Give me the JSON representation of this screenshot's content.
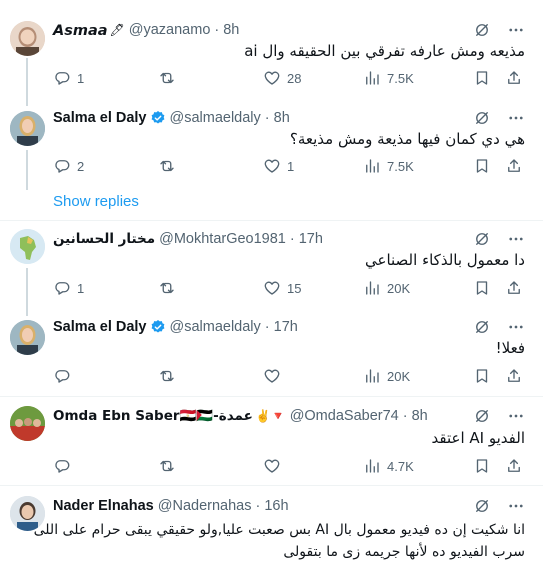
{
  "tweets": [
    {
      "name": "𝘼𝙨𝙢𝙖𝙖",
      "name_suffix": "🖊",
      "handle": "@yazanamo",
      "time": "8h",
      "verified": false,
      "text": "مذيعه ومش عارفه تفرقي بين الحقيقه وال ai",
      "replies": "1",
      "retweets": "",
      "likes": "28",
      "views": "7.5K"
    },
    {
      "name": "Salma el Daly",
      "handle": "@salmaeldaly",
      "time": "8h",
      "verified": true,
      "text": "هي دي كمان فيها مذيعة ومش مذيعة؟",
      "replies": "2",
      "retweets": "",
      "likes": "1",
      "views": "7.5K"
    },
    {
      "name": "مختار الحسانين",
      "handle": "@MokhtarGeo1981",
      "time": "17h",
      "verified": false,
      "text": "دا معمول بالذكاء الصناعي",
      "replies": "1",
      "retweets": "",
      "likes": "15",
      "views": "20K"
    },
    {
      "name": "Salma el Daly",
      "handle": "@salmaeldaly",
      "time": "17h",
      "verified": true,
      "text": "فعلا!",
      "replies": "",
      "retweets": "",
      "likes": "",
      "views": "20K"
    },
    {
      "name": "Omda Ebn Saber🇪🇬🇵🇸-عمدة",
      "name_suffix": "✌️🔻",
      "handle": "@OmdaSaber74",
      "time": "8h",
      "verified": false,
      "text": "الفديو AI اعتقد",
      "replies": "",
      "retweets": "",
      "likes": "",
      "views": "4.7K"
    },
    {
      "name": "Nader Elnahas",
      "handle": "@Nadernahas",
      "time": "16h",
      "verified": false,
      "text_line1": "انا شكيت إن ده فيديو معمول بال AI  بس صعبت عليا,ولو حقيقي يبقى حرام على اللى",
      "text_line2": "سرب الفيديو ده لأنها جريمه زى ما بتقولى"
    }
  ],
  "show_replies": "Show replies",
  "colors": {
    "accent": "#1d9bf0",
    "muted": "#536471",
    "text": "#0f1419",
    "divider": "#eff3f4"
  },
  "icons": [
    "grok-icon",
    "more-icon",
    "reply-icon",
    "retweet-icon",
    "like-icon",
    "views-icon",
    "bookmark-icon",
    "share-icon",
    "verified-badge-icon"
  ]
}
